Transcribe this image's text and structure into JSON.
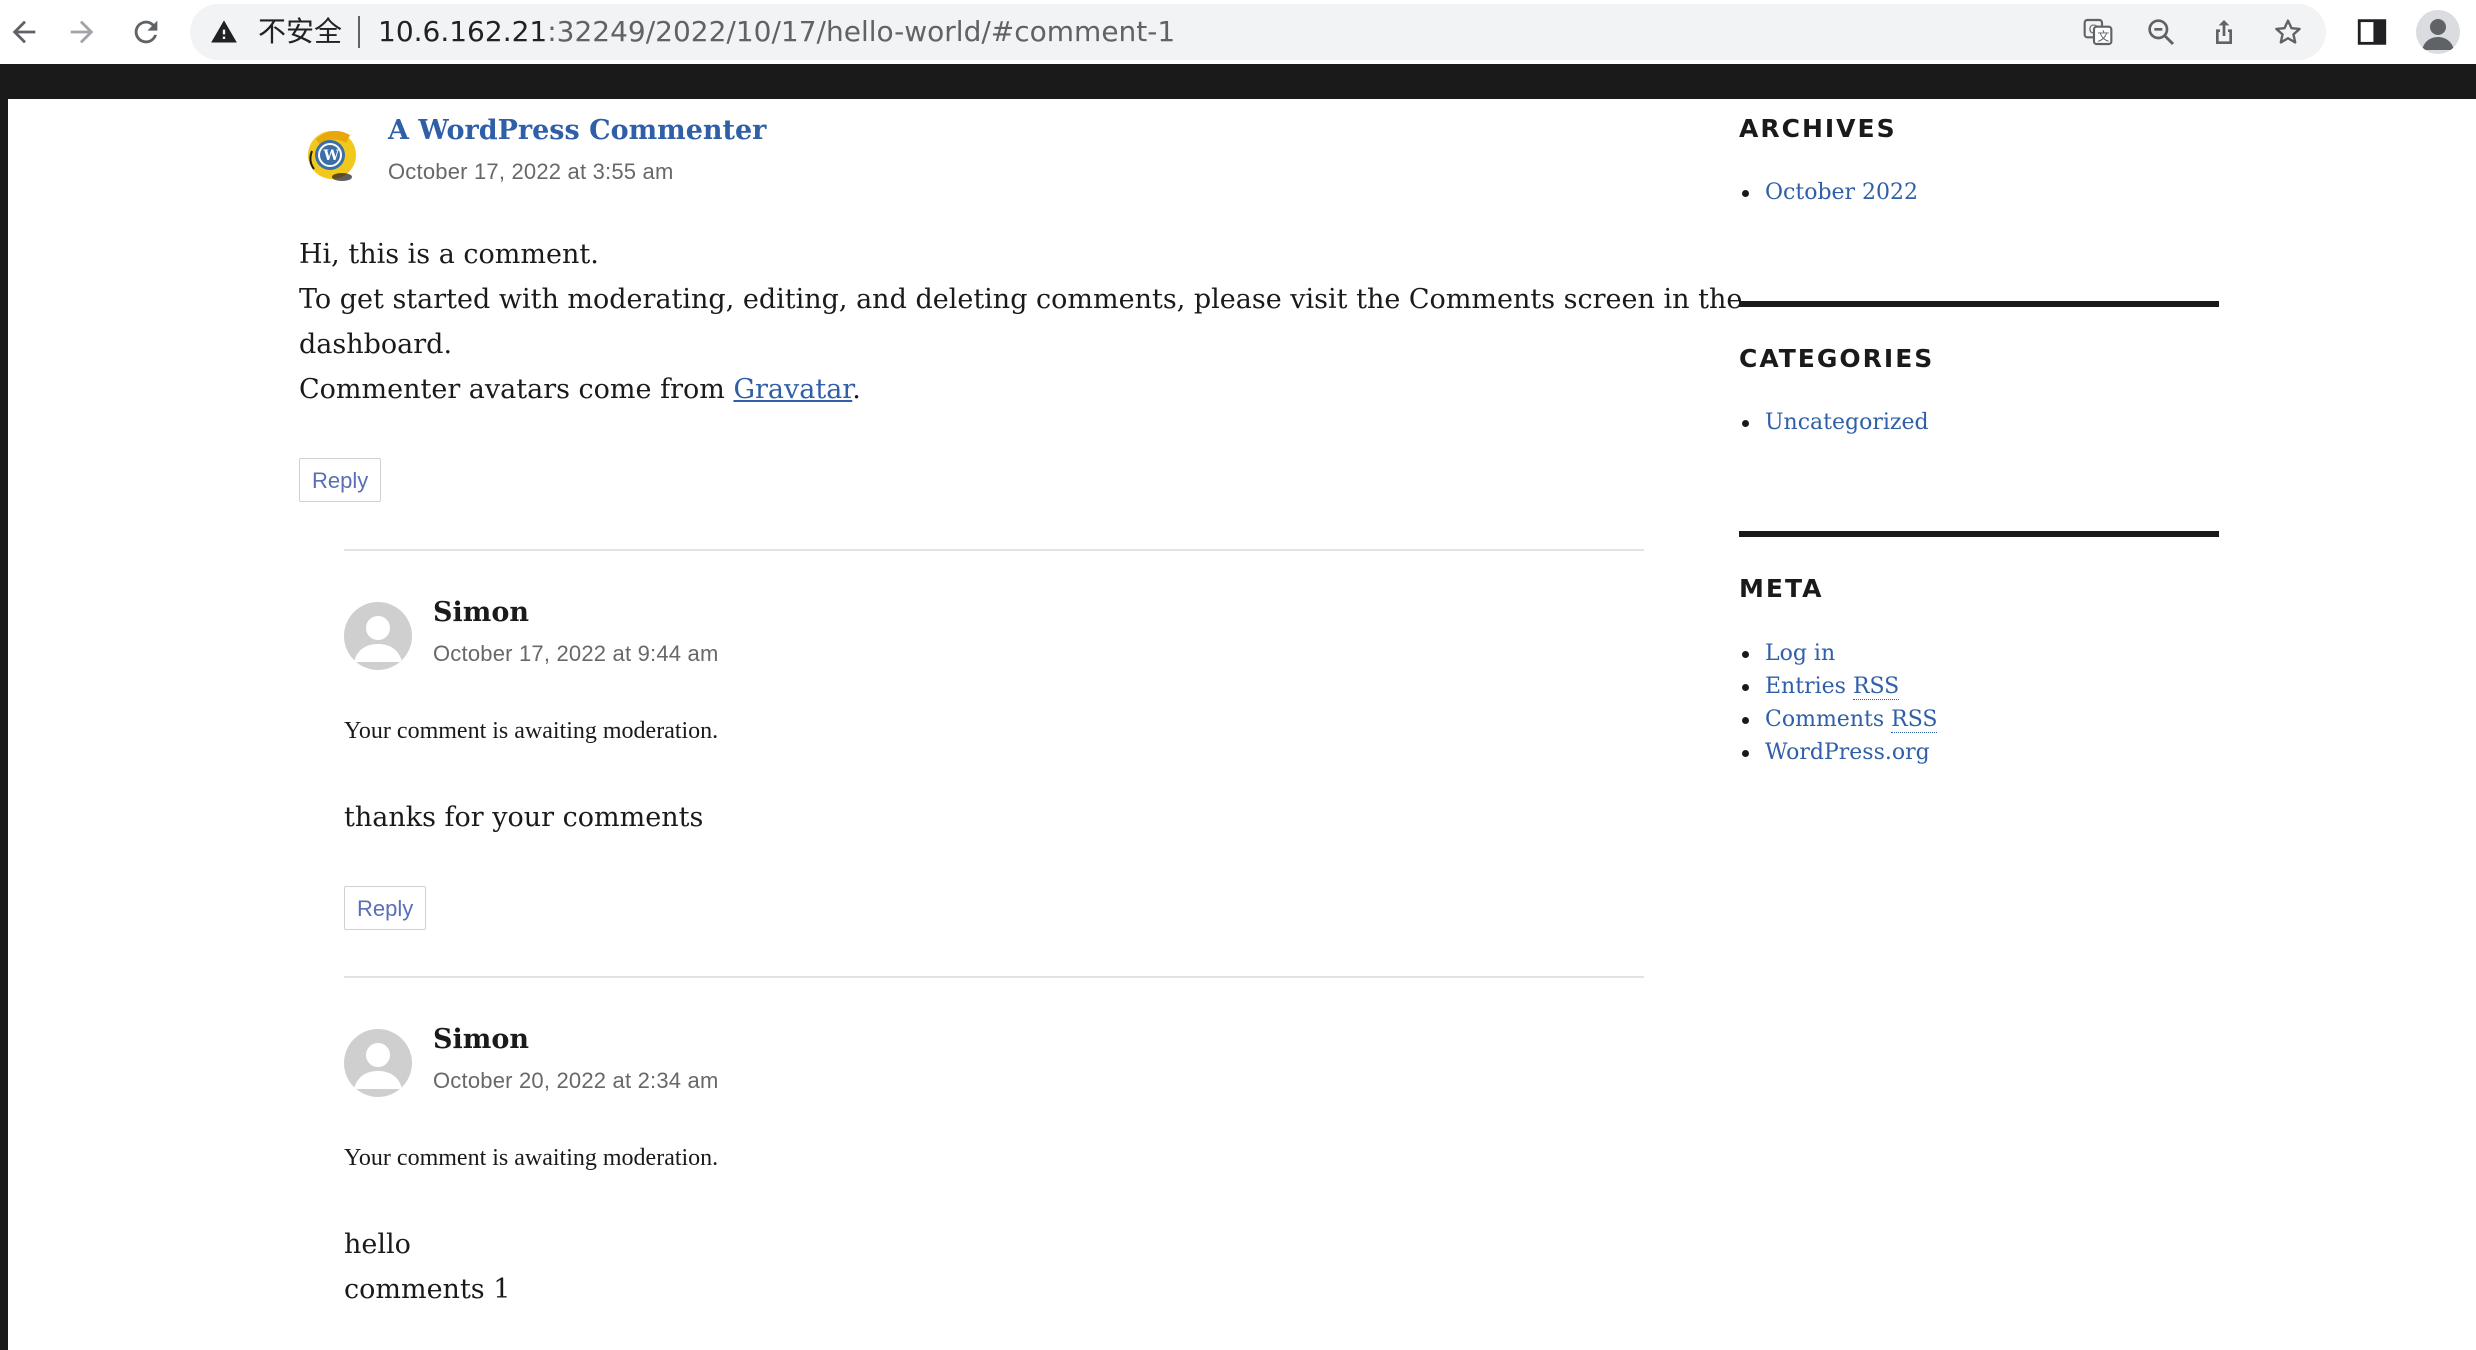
{
  "browser": {
    "security_label": "不安全",
    "url_host": "10.6.162.21",
    "url_rest": ":32249/2022/10/17/hello-world/#comment-1"
  },
  "comments": [
    {
      "author": "A WordPress Commenter",
      "date": "October 17, 2022 at 3:55 am",
      "lines": [
        "Hi, this is a comment.",
        "To get started with moderating, editing, and deleting comments, please visit the Comments screen in the",
        "dashboard."
      ],
      "last_line_prefix": "Commenter avatars come from ",
      "last_line_link": "Gravatar",
      "last_line_suffix": ".",
      "reply": "Reply"
    },
    {
      "author": "Simon",
      "date": "October 17, 2022 at 9:44 am",
      "moderation": "Your comment is awaiting moderation.",
      "lines": [
        "thanks for your comments"
      ],
      "reply": "Reply"
    },
    {
      "author": "Simon",
      "date": "October 20, 2022 at 2:34 am",
      "moderation": "Your comment is awaiting moderation.",
      "lines": [
        "hello",
        "comments 1"
      ]
    }
  ],
  "sidebar": {
    "archives": {
      "title": "ARCHIVES",
      "items": [
        "October 2022"
      ]
    },
    "categories": {
      "title": "CATEGORIES",
      "items": [
        "Uncategorized"
      ]
    },
    "meta": {
      "title": "META",
      "items": [
        {
          "text": "Log in"
        },
        {
          "text": "Entries ",
          "abbr": "RSS"
        },
        {
          "text": "Comments ",
          "abbr": "RSS"
        },
        {
          "text": "WordPress.org"
        }
      ]
    }
  }
}
